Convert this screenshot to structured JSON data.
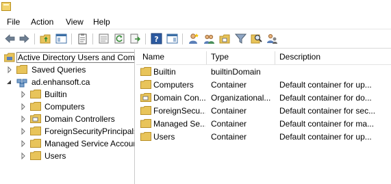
{
  "menu": [
    "File",
    "Action",
    "View",
    "Help"
  ],
  "toolbar_icons": [
    "back-arrow-icon",
    "forward-arrow-icon",
    "up-folder-icon",
    "show-hide-console-tree-icon",
    "clipboard-icon",
    "properties-icon",
    "refresh-icon",
    "export-list-icon",
    "help-icon",
    "show-action-pane-icon",
    "create-user-icon",
    "create-group-icon",
    "create-ou-icon",
    "filter-icon",
    "find-icon",
    "add-to-group-icon"
  ],
  "tree": {
    "root": "Active Directory Users and Com",
    "items": [
      {
        "label": "Saved Queries",
        "level": 1
      },
      {
        "label": "ad.enhansoft.ca",
        "level": 1
      },
      {
        "label": "Builtin",
        "level": 2
      },
      {
        "label": "Computers",
        "level": 2
      },
      {
        "label": "Domain Controllers",
        "level": 2
      },
      {
        "label": "ForeignSecurityPrincipals",
        "level": 2
      },
      {
        "label": "Managed Service Accour",
        "level": 2
      },
      {
        "label": "Users",
        "level": 2
      }
    ]
  },
  "list": {
    "headers": [
      "Name",
      "Type",
      "Description"
    ],
    "rows": [
      {
        "name": "Builtin",
        "type": "builtinDomain",
        "description": ""
      },
      {
        "name": "Computers",
        "type": "Container",
        "description": "Default container for up..."
      },
      {
        "name": "Domain Con...",
        "type": "Organizational...",
        "description": "Default container for do..."
      },
      {
        "name": "ForeignSecu...",
        "type": "Container",
        "description": "Default container for sec..."
      },
      {
        "name": "Managed Se...",
        "type": "Container",
        "description": "Default container for ma..."
      },
      {
        "name": "Users",
        "type": "Container",
        "description": "Default container for up..."
      }
    ]
  },
  "colors": {
    "folder": "#e8c45a",
    "folder_edge": "#b8902a",
    "separator": "#c9c9c9"
  }
}
